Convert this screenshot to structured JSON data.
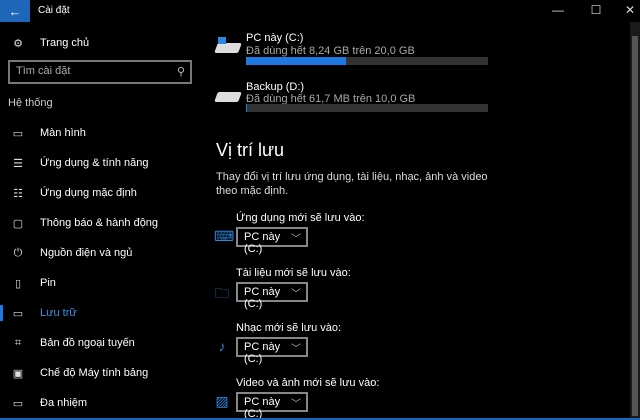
{
  "window": {
    "title": "Cài đặt",
    "back_icon": "arrow-left-icon",
    "minimize": "—",
    "maximize": "☐",
    "close": "✕"
  },
  "sidebar": {
    "home": "Trang chủ",
    "search_placeholder": "Tìm cài đặt",
    "section": "Hệ thống",
    "items": [
      {
        "label": "Màn hình",
        "icon": "monitor-icon",
        "glyph": "▭"
      },
      {
        "label": "Ứng dụng & tính năng",
        "icon": "apps-list-icon",
        "glyph": "☰"
      },
      {
        "label": "Ứng dụng mặc định",
        "icon": "default-apps-icon",
        "glyph": "☷"
      },
      {
        "label": "Thông báo & hành động",
        "icon": "notification-icon",
        "glyph": "▢"
      },
      {
        "label": "Nguồn điện và ngủ",
        "icon": "power-icon",
        "glyph": "⏻"
      },
      {
        "label": "Pin",
        "icon": "battery-icon",
        "glyph": "▯"
      },
      {
        "label": "Lưu trữ",
        "icon": "storage-icon",
        "glyph": "▭"
      },
      {
        "label": "Bản đồ ngoại tuyến",
        "icon": "map-icon",
        "glyph": "⌗"
      },
      {
        "label": "Chế độ Máy tính bảng",
        "icon": "tablet-mode-icon",
        "glyph": "▣"
      },
      {
        "label": "Đa nhiệm",
        "icon": "multitasking-icon",
        "glyph": "▭"
      }
    ],
    "active_index": 6
  },
  "drives": [
    {
      "name": "PC này (C:)",
      "usage": "Đã dùng hết 8,24 GB trên 20,0 GB",
      "fraction": 0.412
    },
    {
      "name": "Backup (D:)",
      "usage": "Đã dùng hết 61,7 MB trên 10,0 GB",
      "fraction": 0.006
    }
  ],
  "save_locations": {
    "heading": "Vị trí lưu",
    "description": "Thay đổi vị trí lưu ứng dụng, tài liệu, nhạc, ảnh và video theo mặc định.",
    "items": [
      {
        "label": "Ứng dụng mới sẽ lưu vào:",
        "value": "PC này (C:)",
        "icon": "keyboard-icon",
        "glyph": "⌨"
      },
      {
        "label": "Tài liệu mới sẽ lưu vào:",
        "value": "PC này (C:)",
        "icon": "documents-folder-icon",
        "glyph": "🗀"
      },
      {
        "label": "Nhạc mới sẽ lưu vào:",
        "value": "PC này (C:)",
        "icon": "music-note-icon",
        "glyph": "♪"
      },
      {
        "label": "Video và ảnh mới sẽ lưu vào:",
        "value": "PC này (C:)",
        "icon": "picture-icon",
        "glyph": "▨"
      }
    ]
  },
  "colors": {
    "accent": "#1e7ae0",
    "titlebar_accent": "#1e67b8"
  }
}
